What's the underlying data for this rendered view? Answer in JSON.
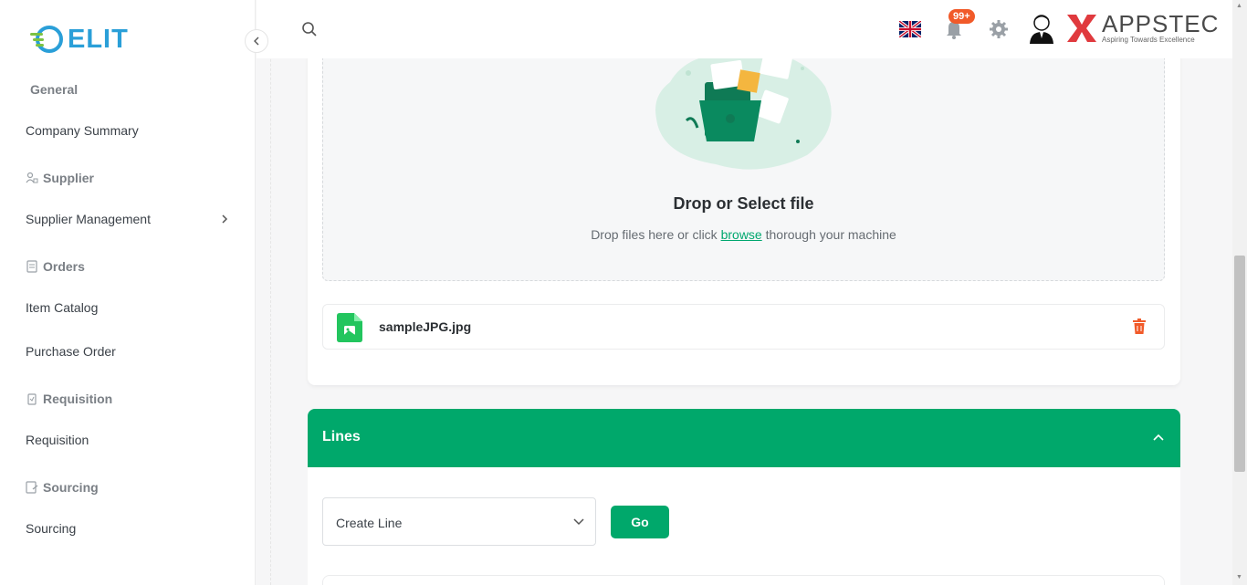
{
  "app": {
    "logo_text": "ELIT"
  },
  "sidebar": {
    "sections": [
      {
        "label": "General"
      },
      {
        "label": "Supplier",
        "icon": "supplier-icon"
      },
      {
        "label": "Orders",
        "icon": "orders-icon"
      },
      {
        "label": "Requisition",
        "icon": "requisition-icon"
      },
      {
        "label": "Sourcing",
        "icon": "sourcing-icon"
      }
    ],
    "items": [
      {
        "label": "Company Summary"
      },
      {
        "label": "Supplier Management"
      },
      {
        "label": "Item Catalog"
      },
      {
        "label": "Purchase Order"
      },
      {
        "label": "Requisition"
      },
      {
        "label": "Sourcing"
      }
    ]
  },
  "header": {
    "notification_count": "99+",
    "brand_name": "APPSTEC",
    "brand_tagline": "Aspiring Towards Excellence"
  },
  "upload": {
    "title": "Drop or Select file",
    "subtitle_before": "Drop files here or click ",
    "browse_link": "browse",
    "subtitle_after": " thorough your machine",
    "file_name": "sampleJPG.jpg"
  },
  "lines": {
    "title": "Lines",
    "select_value": "Create Line",
    "go_label": "Go"
  },
  "colors": {
    "accent": "#00a86b",
    "danger": "#f15a29",
    "logo": "#2a9fd8"
  }
}
